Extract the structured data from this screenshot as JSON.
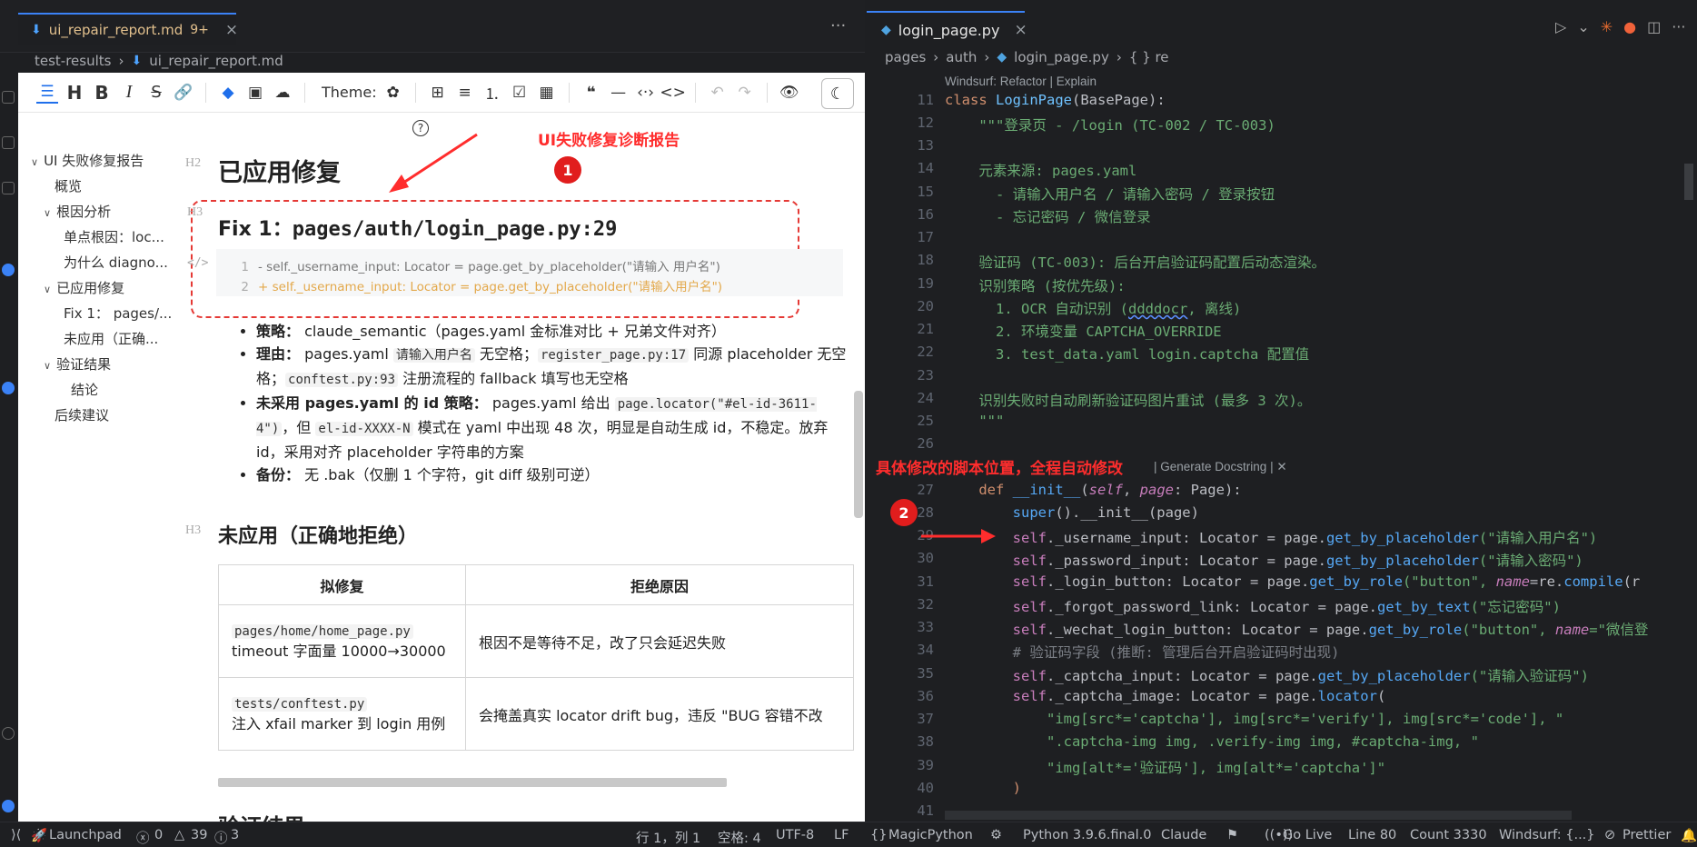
{
  "left_editor": {
    "tab": {
      "name": "ui_repair_report.md",
      "modified": "9+"
    },
    "breadcrumb": [
      "test-results",
      "ui_repair_report.md"
    ]
  },
  "md_toolbar": {
    "theme_label": "Theme:"
  },
  "toc": {
    "items": [
      {
        "label": "UI 失败修复报告",
        "caret": true
      },
      {
        "label": "概览"
      },
      {
        "label": "根因分析",
        "caret": true
      },
      {
        "label": "单点根因：loc..."
      },
      {
        "label": "为什么 diagno..."
      },
      {
        "label": "已应用修复",
        "caret": true
      },
      {
        "label": "Fix 1：",
        "extra": "pages/..."
      },
      {
        "label": "未应用（正确..."
      },
      {
        "label": "验证结果",
        "caret": true
      },
      {
        "label": "结论"
      },
      {
        "label": "后续建议"
      }
    ]
  },
  "doc": {
    "tag_h2": "H2",
    "tag_h3": "H3",
    "tag_code": "</>",
    "h2_applied": "已应用修复",
    "fix_title_prefix": "Fix 1：",
    "fix_title_code": "pages/auth/login_page.py:29",
    "diff": [
      {
        "n": "1",
        "text": "- self._username_input: Locator = page.get_by_placeholder(\"请输入 用户名\")"
      },
      {
        "n": "2",
        "text": "+ self._username_input: Locator = page.get_by_placeholder(\"请输入用户名\")"
      }
    ],
    "bullets": {
      "strategy_label": "策略：",
      "strategy_text": "claude_semantic（pages.yaml 金标准对比 + 兄弟文件对齐）",
      "reason_label": "理由：",
      "reason_a": "pages.yaml",
      "reason_code1": "请输入用户名",
      "reason_b": "无空格；",
      "reason_code2": "register_page.py:17",
      "reason_c": "同源 placeholder 无空格；",
      "reason_code3": "conftest.py:93",
      "reason_d": "注册流程的 fallback 填写也无空格",
      "noid_label": "未采用 pages.yaml 的 id 策略：",
      "noid_a": "pages.yaml 给出",
      "noid_code1": "page.locator(\"#el-id-3611-4\")",
      "noid_b": "，但",
      "noid_code2": "el-id-XXXX-N",
      "noid_c": "模式在 yaml 中出现 48 次，明显是自动生成 id，不稳定。放弃 id，采用对齐 placeholder 字符串的方案",
      "backup_label": "备份：",
      "backup_text": "无 .bak（仅删 1 个字符，git diff 级别可逆）"
    },
    "h3_rejected": "未应用（正确地拒绝）",
    "table": {
      "headers": [
        "拟修复",
        "拒绝原因"
      ],
      "rows": [
        {
          "code": "pages/home/home_page.py",
          "detail": "timeout 字面量 10000→30000",
          "reason": "根因不是等待不足，改了只会延迟失败"
        },
        {
          "code": "tests/conftest.py",
          "detail": "注入 xfail marker 到 login 用例",
          "reason": "会掩盖真实 locator drift bug，违反 \"BUG 容错不改"
        }
      ]
    },
    "h2_next": "验证结果"
  },
  "annotations": {
    "a1_text": "UI失败修复诊断报告",
    "a1_num": "1",
    "a2_text": "具体修改的脚本位置，全程自动修改",
    "a2_num": "2"
  },
  "right_editor": {
    "tab": {
      "name": "login_page.py"
    },
    "breadcrumb": [
      "pages",
      "auth",
      "login_page.py",
      "{ } re"
    ],
    "codelens_top": "Windsurf: Refactor | Explain",
    "codelens_mid": "| Generate Docstring | ✕",
    "lines": {
      "l11a": "class ",
      "l11b": "LoginPage",
      "l11c": "(BasePage):",
      "l12": "    \"\"\"登录页 - /login (TC-002 / TC-003)",
      "l14": "    元素来源: pages.yaml",
      "l15": "      - 请输入用户名 / 请输入密码 / 登录按钮",
      "l16": "      - 忘记密码 / 微信登录",
      "l18": "    验证码 (TC-003): 后台开启验证码配置后动态渲染。",
      "l19": "    识别策略 (按优先级):",
      "l20a": "      1. OCR 自动识别 (",
      "l20b": "ddddocr",
      "l20c": ", 离线)",
      "l21": "      2. 环境变量 CAPTCHA_OVERRIDE",
      "l22": "      3. test_data.yaml login.captcha 配置值",
      "l24": "    识别失败时自动刷新验证码图片重试 (最多 3 次)。",
      "l25": "    \"\"\"",
      "l27": "    def __init__(self, page: Page):",
      "l28": "        super().__init__(page)",
      "l29a": "self",
      "l29b": "._username_input: Locator = page.",
      "l29c": "get_by_placeholder",
      "l29d": "(\"请输入用户名\")",
      "l30a": "self",
      "l30b": "._password_input: Locator = page.",
      "l30c": "get_by_placeholder",
      "l30d": "(\"请输入密码\")",
      "l31a": "self",
      "l31b": "._login_button: Locator = page.",
      "l31c": "get_by_role",
      "l31d": "(\"button\", ",
      "l31e": "name",
      "l31f": "=re.",
      "l31g": "compile",
      "l31h": "(r",
      "l32a": "self",
      "l32b": "._forgot_password_link: Locator = page.",
      "l32c": "get_by_text",
      "l32d": "(\"忘记密码\")",
      "l33a": "self",
      "l33b": "._wechat_login_button: Locator = page.",
      "l33c": "get_by_role",
      "l33d": "(\"button\", ",
      "l33e": "name",
      "l33f": "=\"微信登",
      "l34": "# 验证码字段 (推断: 管理后台开启验证码时出现)",
      "l35a": "self",
      "l35b": "._captcha_input: Locator = page.",
      "l35c": "get_by_placeholder",
      "l35d": "(\"请输入验证码\")",
      "l36a": "self",
      "l36b": "._captcha_image: Locator = page.",
      "l36c": "locator",
      "l36d": "(",
      "l37": "\"img[src*='captcha'], img[src*='verify'], img[src*='code'], \"",
      "l38": "\".captcha-img img, .verify-img img, #captcha-img, \"",
      "l39": "\"img[alt*='验证码'], img[alt*='captcha']\"",
      "l40": ")"
    }
  },
  "status_bar": {
    "launchpad": "Launchpad",
    "errors": "0",
    "warnings": "39",
    "infos": "3",
    "position": "行 1，列 1",
    "spaces": "空格: 4",
    "encoding": "UTF-8",
    "eol": "LF",
    "lang": "MagicPython",
    "python": "Python 3.9.6.final.0",
    "claude": "Claude",
    "golive": "Go Live",
    "line": "Line 80",
    "count": "Count 3330",
    "windsurf": "Windsurf: {...}",
    "prettier": "Prettier"
  }
}
